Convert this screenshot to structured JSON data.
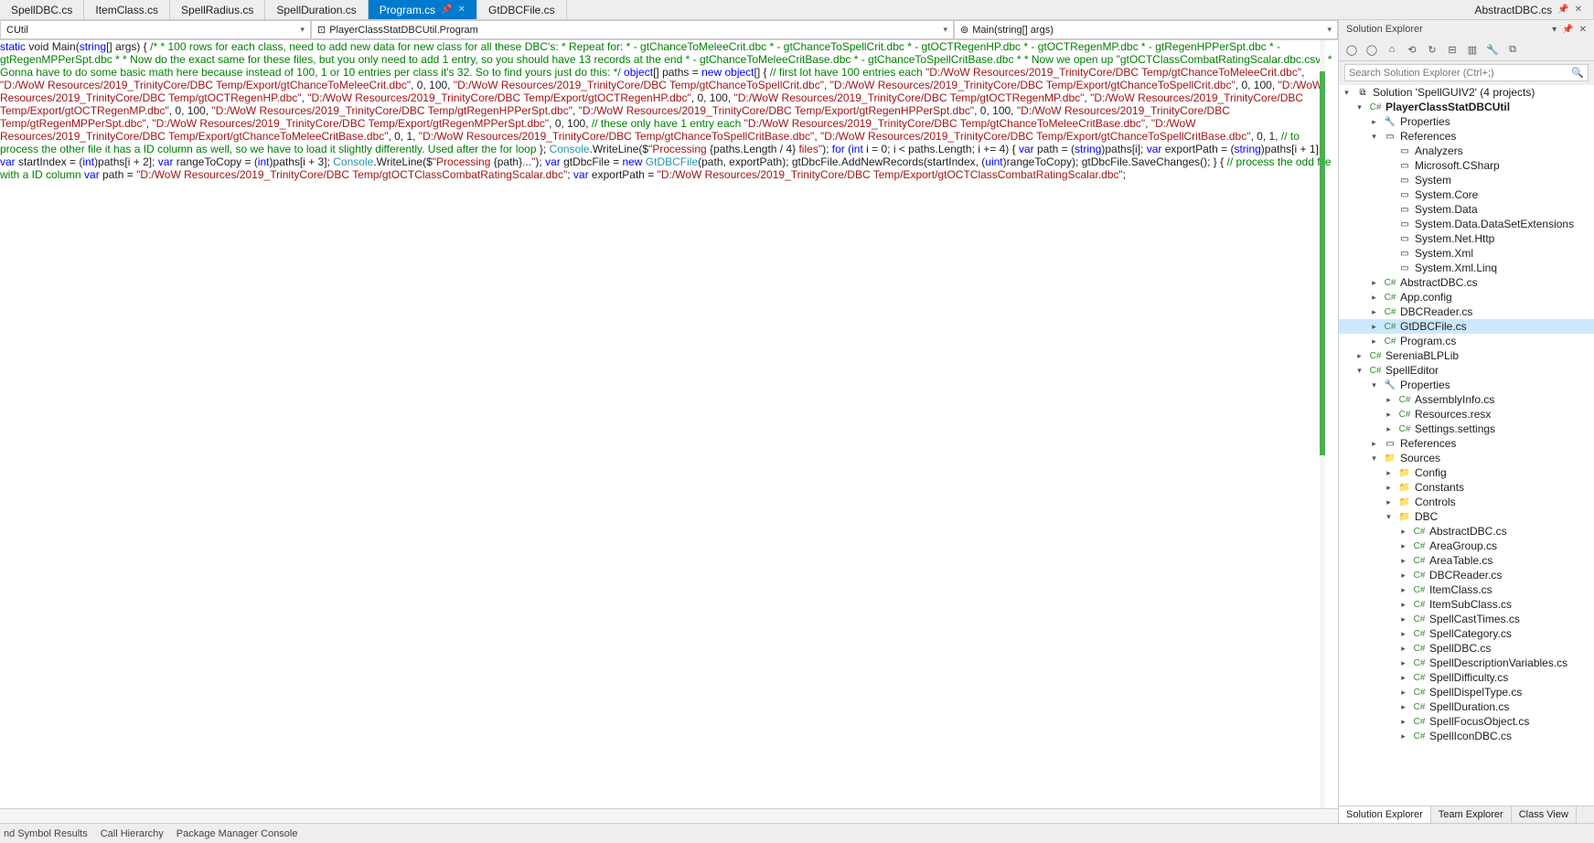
{
  "tabs": {
    "left": [
      "SpellDBC.cs",
      "ItemClass.cs",
      "SpellRadius.cs",
      "SpellDuration.cs"
    ],
    "active": "Program.cs",
    "afterActive": [
      "GtDBCFile.cs"
    ],
    "right": [
      "AbstractDBC.cs"
    ]
  },
  "nav": {
    "combo1": "CUtil",
    "combo2_icon": "⊡",
    "combo2": "PlayerClassStatDBCUtil.Program",
    "combo3_icon": "⊚",
    "combo3": "Main(string[] args)"
  },
  "code": {
    "l1a": "static",
    "l1b": " void ",
    "l1c": "Main",
    "l1d": "(",
    "l1e": "string",
    "l1f": "[] args)",
    "l2": "{",
    "c1": "/*",
    "c2": " * 100 rows for each class, need to add new data for new class for all these DBC's:",
    "c3": " * Repeat for:",
    "c4": " * - gtChanceToMeleeCrit.dbc",
    "c5": " * - gtChanceToSpellCrit.dbc",
    "c6": " * - gtOCTRegenHP.dbc",
    "c7": " * - gtOCTRegenMP.dbc",
    "c8": " * - gtRegenHPPerSpt.dbc",
    "c9": " * - gtRegenMPPerSpt.dbc",
    "c10": " *",
    "c11": " * Now do the exact same for these files, but you only need to add 1 entry, so you should have 13 records at the end",
    "c12": " * - gtChanceToMeleeCritBase.dbc",
    "c13": " * - gtChanceToSpellCritBase.dbc",
    "c14": " *",
    "c15": " * Now we open up \"gtOCTClassCombatRatingScalar.dbc.csv\"",
    "c16": " * Gonna have to do some basic math here because instead of 100, 1 or 10 entries per class it's 32. So to find yours just do this:",
    "c17": " */",
    "o1a": "object",
    "o1b": "[] paths = ",
    "o1c": "new",
    "o1d": " object",
    "o1e": "[]",
    "ob": "{",
    "pc1": "// first lot have 100 entries each",
    "p1a": "\"D:/WoW Resources/2019_TrinityCore/DBC Temp/gtChanceToMeleeCrit.dbc\"",
    "p1b": ", ",
    "p1c": "\"D:/WoW Resources/2019_TrinityCore/DBC Temp/Export/gtChanceToMeleeCrit.dbc\"",
    "p1d": ", 0, 100,",
    "p2a": "\"D:/WoW Resources/2019_TrinityCore/DBC Temp/gtChanceToSpellCrit.dbc\"",
    "p2b": ", ",
    "p2c": "\"D:/WoW Resources/2019_TrinityCore/DBC Temp/Export/gtChanceToSpellCrit.dbc\"",
    "p2d": ", 0, 100,",
    "p3a": "\"D:/WoW Resources/2019_TrinityCore/DBC Temp/gtOCTRegenHP.dbc\"",
    "p3b": ", ",
    "p3c": "\"D:/WoW Resources/2019_TrinityCore/DBC Temp/Export/gtOCTRegenHP.dbc\"",
    "p3d": ", 0, 100,",
    "p4a": "\"D:/WoW Resources/2019_TrinityCore/DBC Temp/gtOCTRegenMP.dbc\"",
    "p4b": ", ",
    "p4c": "\"D:/WoW Resources/2019_TrinityCore/DBC Temp/Export/gtOCTRegenMP.dbc\"",
    "p4d": ", 0, 100,",
    "p5a": "\"D:/WoW Resources/2019_TrinityCore/DBC Temp/gtRegenHPPerSpt.dbc\"",
    "p5b": ", ",
    "p5c": "\"D:/WoW Resources/2019_TrinityCore/DBC Temp/Export/gtRegenHPPerSpt.dbc\"",
    "p5d": ", 0, 100,",
    "p6a": "\"D:/WoW Resources/2019_TrinityCore/DBC Temp/gtRegenMPPerSpt.dbc\"",
    "p6b": ", ",
    "p6c": "\"D:/WoW Resources/2019_TrinityCore/DBC Temp/Export/gtRegenMPPerSpt.dbc\"",
    "p6d": ", 0, 100,",
    "pc2": "// these only have 1 entry each",
    "p7a": "\"D:/WoW Resources/2019_TrinityCore/DBC Temp/gtChanceToMeleeCritBase.dbc\"",
    "p7b": ", ",
    "p7c": "\"D:/WoW Resources/2019_TrinityCore/DBC Temp/Export/gtChanceToMeleeCritBase.dbc\"",
    "p7d": ", 0, 1,",
    "p8a": "\"D:/WoW Resources/2019_TrinityCore/DBC Temp/gtChanceToSpellCritBase.dbc\"",
    "p8b": ", ",
    "p8c": "\"D:/WoW Resources/2019_TrinityCore/DBC Temp/Export/gtChanceToSpellCritBase.dbc\"",
    "p8d": ", 0, 1,",
    "pc3": "// to process the other file it has a ID column as well, so we have to load it slightly differently. Used after the for loop",
    "oe": "};",
    "w1a": "Console",
    "w1b": ".WriteLine($",
    "w1c": "\"Processing ",
    "w1d": "{paths.Length / 4}",
    "w1e": " files\"",
    "w1f": ");",
    "f1a": "for",
    "f1b": " (",
    "f1c": "int",
    "f1d": " i = 0; i < paths.Length; i += 4)",
    "fb": "{",
    "v1a": "var",
    "v1b": " path = (",
    "v1c": "string",
    "v1d": ")paths[i];",
    "v2a": "var",
    "v2b": " exportPath = (",
    "v2c": "string",
    "v2d": ")paths[i + 1];",
    "v3a": "var",
    "v3b": " startIndex = (",
    "v3c": "int",
    "v3d": ")paths[i + 2];",
    "v4a": "var",
    "v4b": " rangeToCopy = (",
    "v4c": "int",
    "v4d": ")paths[i + 3];",
    "w2a": "Console",
    "w2b": ".WriteLine($",
    "w2c": "\"Processing ",
    "w2d": "{path}",
    "w2e": "...\"",
    "w2f": ");",
    "g1a": "var",
    "g1b": " gtDbcFile = ",
    "g1c": "new",
    "g1d": " ",
    "g1e": "GtDBCFile",
    "g1f": "(path, exportPath);",
    "g2": "gtDbcFile.AddNewRecords(startIndex, (",
    "g2b": "uint",
    "g2c": ")rangeToCopy);",
    "g3": "gtDbcFile.SaveChanges();",
    "fe": "}",
    "ob2": "{",
    "pc4": "// process the odd file with a ID column",
    "v5a": "var",
    "v5b": " path = ",
    "v5c": "\"D:/WoW Resources/2019_TrinityCore/DBC Temp/gtOCTClassCombatRatingScalar.dbc\"",
    "v5d": ";",
    "v6a": "var",
    "v6b": " exportPath = ",
    "v6c": "\"D:/WoW Resources/2019_TrinityCore/DBC Temp/Export/gtOCTClassCombatRatingScalar.dbc\"",
    "v6d": ";"
  },
  "se": {
    "title": "Solution Explorer",
    "search_ph": "Search Solution Explorer (Ctrl+;)",
    "solution": "Solution 'SpellGUIV2' (4 projects)",
    "proj1": "PlayerClassStatDBCUtil",
    "props": "Properties",
    "refs": "References",
    "ref_items": [
      "Analyzers",
      "Microsoft.CSharp",
      "System",
      "System.Core",
      "System.Data",
      "System.Data.DataSetExtensions",
      "System.Net.Http",
      "System.Xml",
      "System.Xml.Linq"
    ],
    "proj1_files": [
      "AbstractDBC.cs",
      "App.config",
      "DBCReader.cs",
      "GtDBCFile.cs",
      "Program.cs"
    ],
    "proj2": "SereniaBLPLib",
    "proj3": "SpellEditor",
    "proj3_props": "Properties",
    "proj3_prop_items": [
      "AssemblyInfo.cs",
      "Resources.resx",
      "Settings.settings"
    ],
    "proj3_refs": "References",
    "sources": "Sources",
    "src_folders": [
      "Config",
      "Constants",
      "Controls"
    ],
    "dbc": "DBC",
    "dbc_files": [
      "AbstractDBC.cs",
      "AreaGroup.cs",
      "AreaTable.cs",
      "DBCReader.cs",
      "ItemClass.cs",
      "ItemSubClass.cs",
      "SpellCastTimes.cs",
      "SpellCategory.cs",
      "SpellDBC.cs",
      "SpellDescriptionVariables.cs",
      "SpellDifficulty.cs",
      "SpellDispelType.cs",
      "SpellDuration.cs",
      "SpellFocusObject.cs",
      "SpellIconDBC.cs"
    ]
  },
  "side_tabs": [
    "Solution Explorer",
    "Team Explorer",
    "Class View"
  ],
  "bottom": [
    "nd Symbol Results",
    "Call Hierarchy",
    "Package Manager Console"
  ]
}
